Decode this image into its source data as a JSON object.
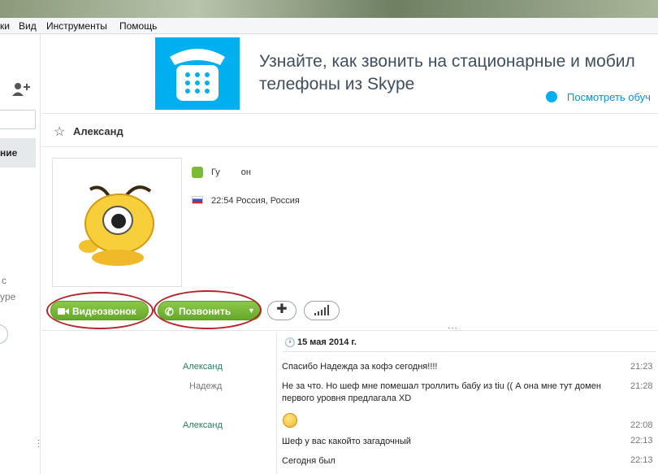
{
  "menu": [
    "ки",
    "Вид",
    "Инструменты",
    "Помощь"
  ],
  "left_panel": {
    "selected_label": "ние",
    "text1": "с",
    "text2": "ype"
  },
  "banner": {
    "line1": "Узнайте, как звонить на стационарные и мобил",
    "line2": "телефоны из Skype",
    "more_link": "Посмотреть обуч"
  },
  "contact": {
    "name": "Александ",
    "status_text": "Гу",
    "status_text_end": "он",
    "local_time": "22:54 Россия, Россия"
  },
  "actions": {
    "video_call": "Видеозвонок",
    "call": "Позвонить"
  },
  "chat": {
    "date": "15 мая 2014 г.",
    "messages": [
      {
        "sender": "Александ",
        "text": "Спасибо Надежда за кофэ сегодня!!!!",
        "time": "21:23"
      },
      {
        "sender": "Надежд",
        "text": "Не за что. Но шеф мне помешал троллить бабу из tiu (( А она мне тут домен первого уровня предлагала XD",
        "time": "21:28"
      },
      {
        "sender": "Александ",
        "text": "",
        "time": "22:08"
      },
      {
        "sender": "",
        "text": "Шеф у вас какойто загадочный",
        "time": "22:13"
      },
      {
        "sender": "",
        "text": "Сегодня был",
        "time": "22:13"
      }
    ]
  },
  "colors": {
    "skype_blue": "#00aff0",
    "call_green": "#72b22e",
    "highlight_red": "#b2262b"
  }
}
